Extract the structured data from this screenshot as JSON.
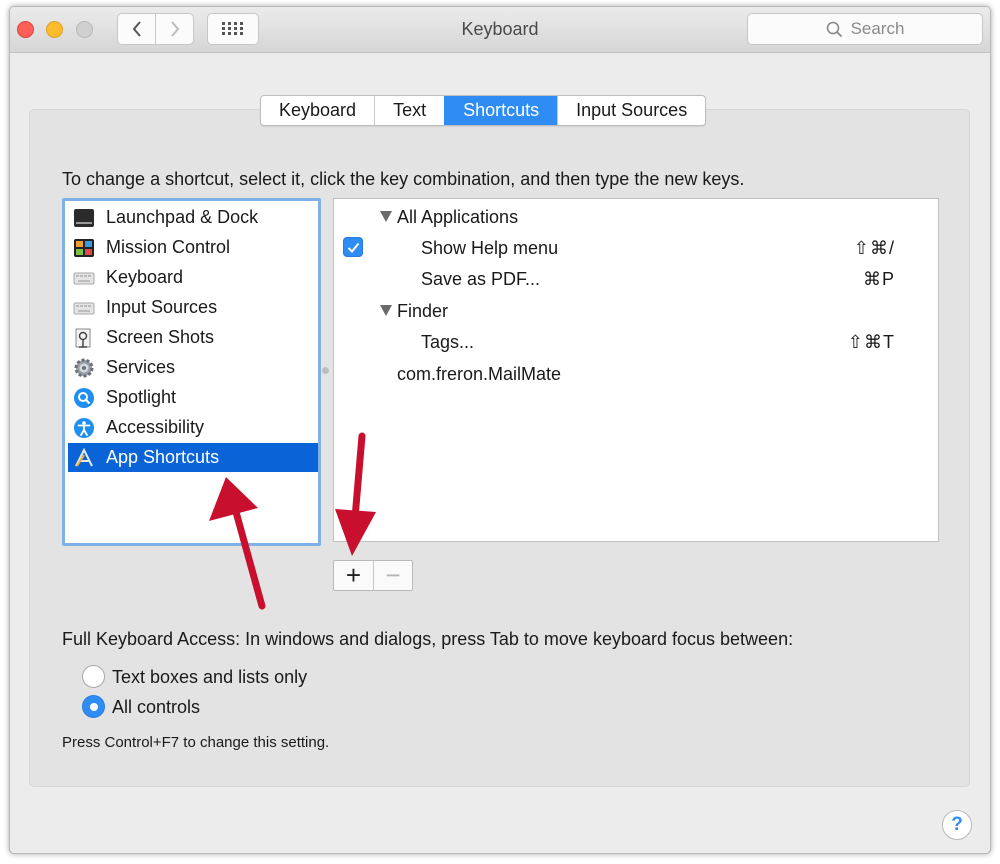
{
  "window": {
    "title": "Keyboard"
  },
  "toolbar": {
    "search_placeholder": "Search"
  },
  "tabs": [
    {
      "label": "Keyboard",
      "active": false
    },
    {
      "label": "Text",
      "active": false
    },
    {
      "label": "Shortcuts",
      "active": true
    },
    {
      "label": "Input Sources",
      "active": false
    }
  ],
  "instruction": "To change a shortcut, select it, click the key combination, and then type the new keys.",
  "categories": [
    {
      "label": "Launchpad & Dock",
      "icon": "launchpad-icon",
      "selected": false
    },
    {
      "label": "Mission Control",
      "icon": "mission-control-icon",
      "selected": false
    },
    {
      "label": "Keyboard",
      "icon": "keyboard-icon",
      "selected": false
    },
    {
      "label": "Input Sources",
      "icon": "keyboard-icon",
      "selected": false
    },
    {
      "label": "Screen Shots",
      "icon": "screenshot-icon",
      "selected": false
    },
    {
      "label": "Services",
      "icon": "gear-icon",
      "selected": false
    },
    {
      "label": "Spotlight",
      "icon": "spotlight-icon",
      "selected": false
    },
    {
      "label": "Accessibility",
      "icon": "accessibility-icon",
      "selected": false
    },
    {
      "label": "App Shortcuts",
      "icon": "app-store-icon",
      "selected": true
    }
  ],
  "shortcuts": {
    "group_all": "All Applications",
    "show_help": {
      "label": "Show Help menu",
      "keys": "⇧⌘/",
      "checked": true
    },
    "save_pdf": {
      "label": "Save as PDF...",
      "keys": "⌘P"
    },
    "group_finder": "Finder",
    "tags": {
      "label": "Tags...",
      "keys": "⇧⌘T"
    },
    "mailmate": "com.freron.MailMate"
  },
  "buttons": {
    "add": "+",
    "remove": "−"
  },
  "full_keyboard_access": {
    "label": "Full Keyboard Access: In windows and dialogs, press Tab to move keyboard focus between:",
    "options": [
      {
        "label": "Text boxes and lists only",
        "selected": false
      },
      {
        "label": "All controls",
        "selected": true
      }
    ],
    "hint": "Press Control+F7 to change this setting."
  },
  "help": {
    "label": "?"
  },
  "colors": {
    "accent": "#2f8cf4",
    "selection": "#0a63d7",
    "annotation": "#c8102e"
  }
}
